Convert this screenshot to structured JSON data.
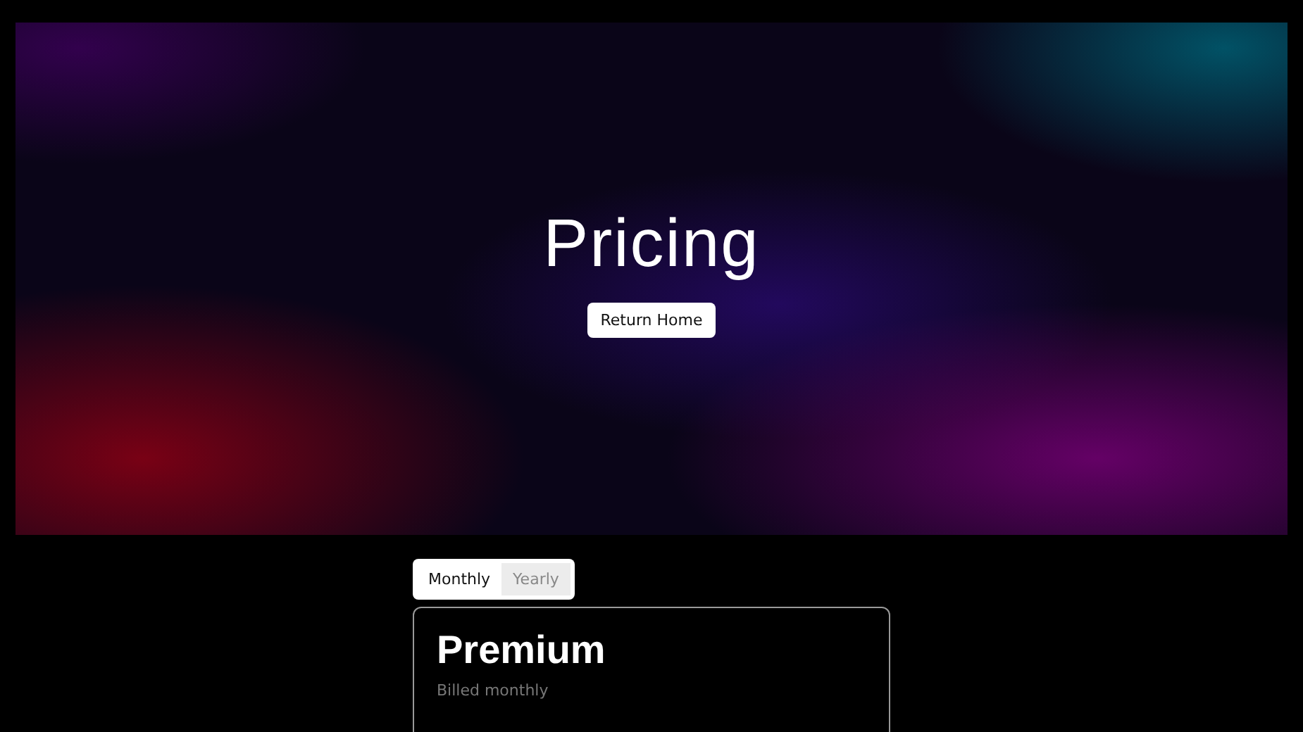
{
  "hero": {
    "title": "Pricing",
    "button": "Return Home"
  },
  "billing_tabs": [
    {
      "label": "Monthly",
      "selected": true
    },
    {
      "label": "Yearly",
      "selected": false
    }
  ],
  "plan": {
    "name": "Premium",
    "billing": "Billed monthly"
  }
}
